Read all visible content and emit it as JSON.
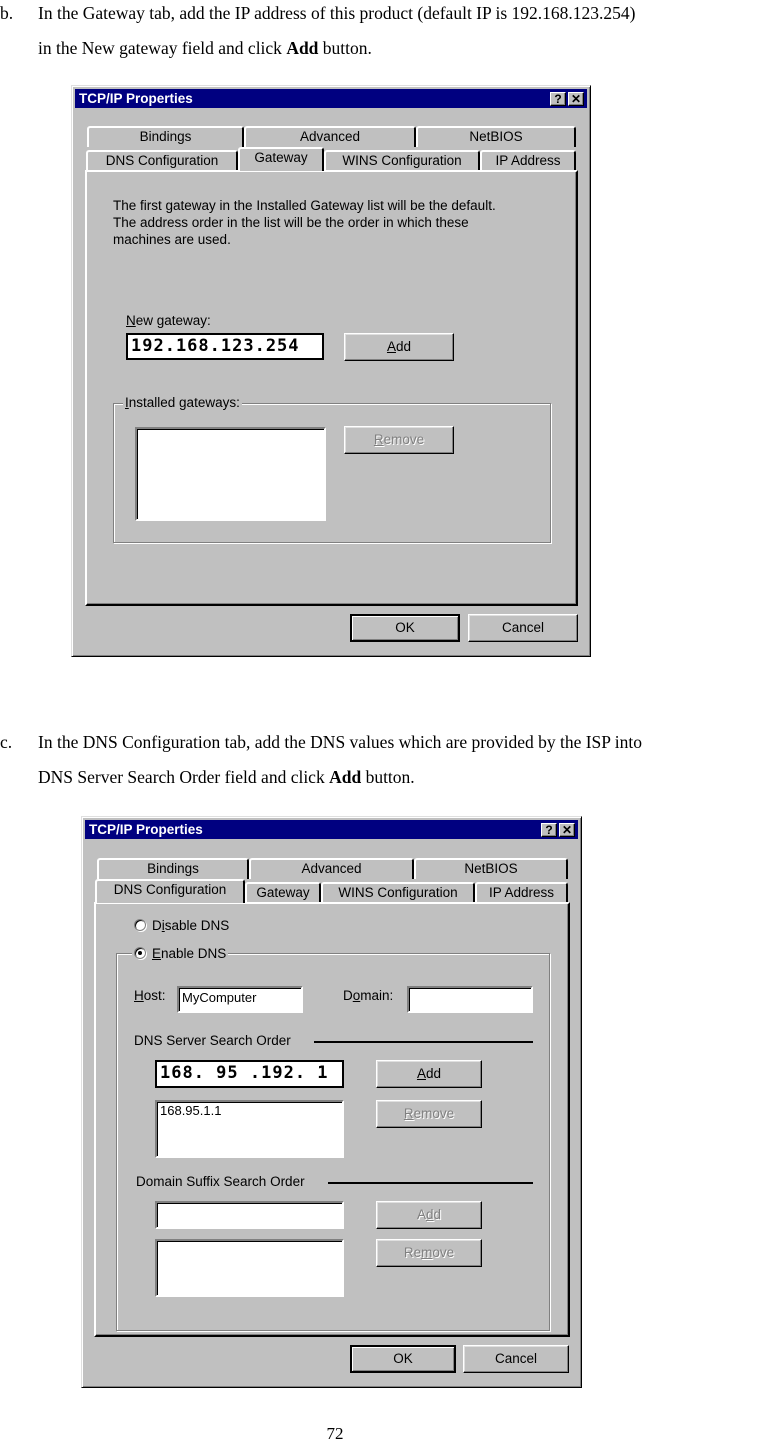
{
  "step_b": {
    "marker": "b.",
    "line1": "In the Gateway tab, add the IP address of this product (default IP is 192.168.123.254)",
    "line2_pre": "in the New gateway field and click ",
    "line2_bold": "Add",
    "line2_post": " button."
  },
  "dialog1": {
    "title": "TCP/IP Properties",
    "help_icon": "?",
    "close_icon": "✕",
    "tabs_row1": [
      "Bindings",
      "Advanced",
      "NetBIOS"
    ],
    "tabs_row2": [
      "DNS Configuration",
      "Gateway",
      "WINS Configuration",
      "IP Address"
    ],
    "active_tab": "Gateway",
    "description": [
      "The first gateway in the Installed Gateway list will be the default.",
      "The address order in the list will be the order in which these",
      "machines are used."
    ],
    "new_gateway_label": "New gateway:",
    "new_gateway_value": "192.168.123.254",
    "add_button": "Add",
    "installed_gateways_label": "Installed gateways:",
    "installed_gateways": [],
    "remove_button": "Remove",
    "ok_button": "OK",
    "cancel_button": "Cancel"
  },
  "step_c": {
    "marker": "c.",
    "line1": "In the DNS Configuration tab, add the DNS values which are provided by the ISP into",
    "line2_pre": "DNS Server Search Order field and click ",
    "line2_bold": "Add",
    "line2_post": " button."
  },
  "dialog2": {
    "title": "TCP/IP Properties",
    "help_icon": "?",
    "close_icon": "✕",
    "tabs_row1": [
      "Bindings",
      "Advanced",
      "NetBIOS"
    ],
    "tabs_row2": [
      "DNS Configuration",
      "Gateway",
      "WINS Configuration",
      "IP Address"
    ],
    "active_tab": "DNS Configuration",
    "disable_dns_label": "Disable DNS",
    "enable_dns_label": "Enable DNS",
    "enable_dns_selected": true,
    "host_label": "Host:",
    "host_value": "MyComputer",
    "domain_label": "Domain:",
    "domain_value": "",
    "dns_order_label": "DNS Server Search Order",
    "dns_input_value": "168. 95 .192.  1",
    "dns_add_button": "Add",
    "dns_list": [
      "168.95.1.1"
    ],
    "dns_remove_button": "Remove",
    "suffix_label": "Domain Suffix Search Order",
    "suffix_input_value": "",
    "suffix_add_button": "Add",
    "suffix_list": [],
    "suffix_remove_button": "Remove",
    "ok_button": "OK",
    "cancel_button": "Cancel"
  },
  "page_number": "72"
}
